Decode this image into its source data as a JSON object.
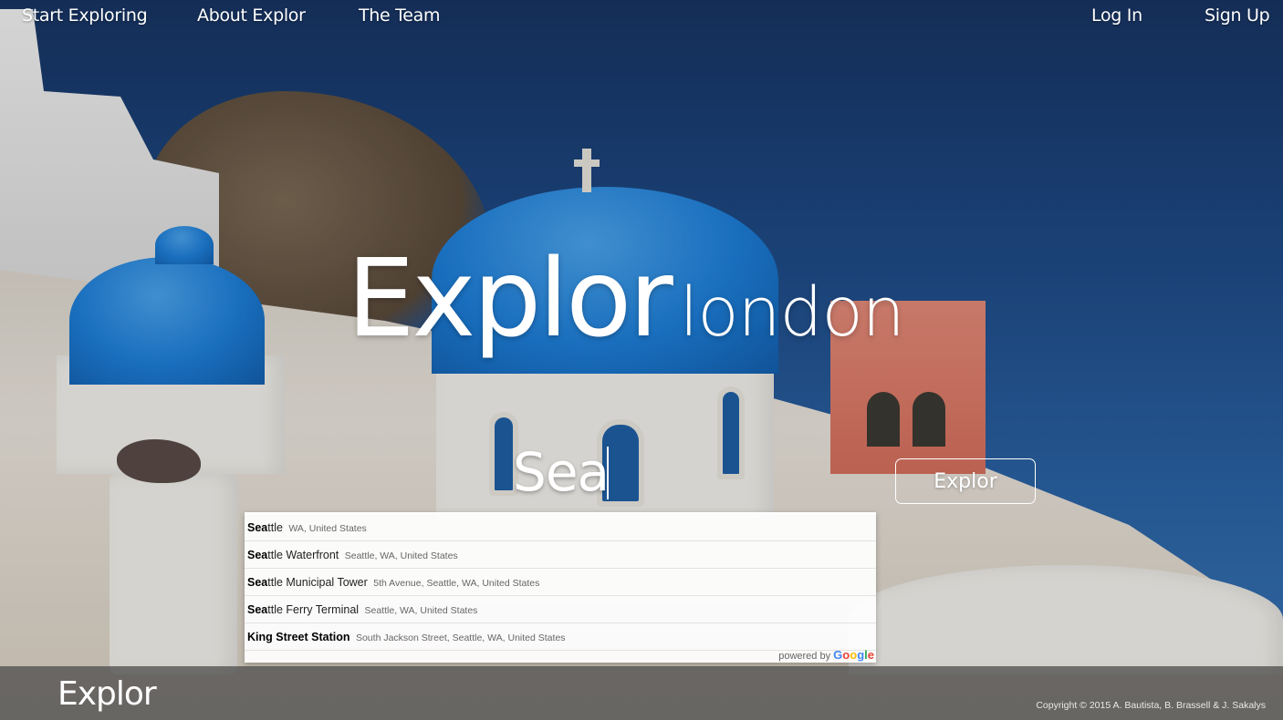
{
  "nav": {
    "start_exploring": "Start Exploring",
    "about": "About Explor",
    "team": "The Team",
    "login": "Log In",
    "signup": "Sign Up"
  },
  "hero": {
    "brand": "Explor",
    "city": "london"
  },
  "search": {
    "value": "Sea",
    "button_label": "Explor"
  },
  "autocomplete": {
    "items": [
      {
        "match": "Sea",
        "rest": "ttle",
        "secondary": "WA, United States"
      },
      {
        "match": "Sea",
        "rest": "ttle Waterfront",
        "secondary": "Seattle, WA, United States"
      },
      {
        "match": "Sea",
        "rest": "ttle Municipal Tower",
        "secondary": "5th Avenue, Seattle, WA, United States"
      },
      {
        "match": "Sea",
        "rest": "ttle Ferry Terminal",
        "secondary": "Seattle, WA, United States"
      },
      {
        "match": "King Street Station",
        "rest": "",
        "secondary": "South Jackson Street, Seattle, WA, United States"
      }
    ],
    "powered_by": "powered by",
    "google": "Google"
  },
  "footer": {
    "logo": "Explor",
    "copyright": "Copyright © 2015 A. Bautista, B. Brassell & J. Sakalys"
  },
  "colors": {
    "dome_blue": "#1d7ed8",
    "sea_blue": "#1e4a86",
    "bell_tower": "#d66f5d",
    "footer_bg": "#464646"
  }
}
